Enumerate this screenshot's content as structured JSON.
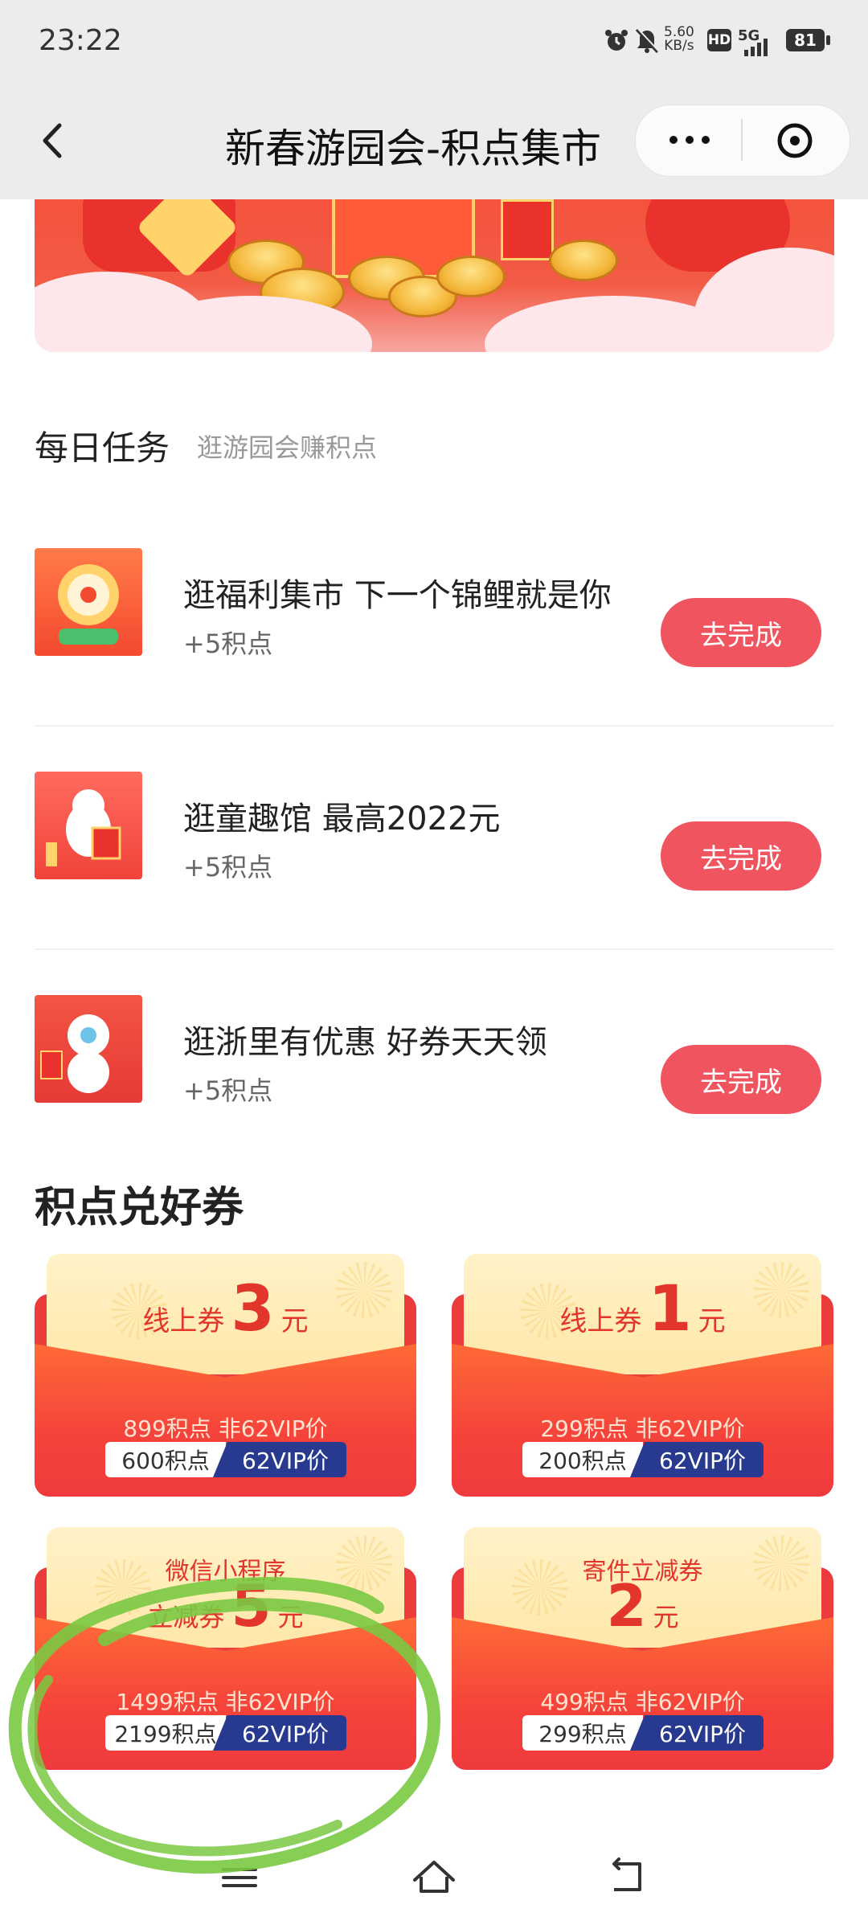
{
  "status_bar": {
    "time": "23:22",
    "net_speed_value": "5.60",
    "net_speed_unit": "KB/s",
    "hd": "HD",
    "network": "5G",
    "battery": "81"
  },
  "nav": {
    "title": "新春游园会-积点集市"
  },
  "daily": {
    "title": "每日任务",
    "subtitle": "逛游园会赚积点",
    "tasks": [
      {
        "title": "逛福利集市 下一个锦鲤就是你",
        "points": "+5积点",
        "button": "去完成"
      },
      {
        "title": "逛童趣馆 最高2022元",
        "points": "+5积点",
        "button": "去完成"
      },
      {
        "title": "逛浙里有优惠 好券天天领",
        "points": "+5积点",
        "button": "去完成"
      }
    ]
  },
  "coupons": {
    "title": "积点兑好券",
    "items": [
      {
        "prefix": "线上券",
        "amount": "3",
        "unit": "元",
        "orig": "899积点  非62VIP价",
        "pts": "600积点",
        "vip": "62VIP价"
      },
      {
        "prefix": "线上券",
        "amount": "1",
        "unit": "元",
        "orig": "299积点  非62VIP价",
        "pts": "200积点",
        "vip": "62VIP价"
      },
      {
        "line1": "微信小程序",
        "line2_prefix": "立减券",
        "amount": "5",
        "unit": "元",
        "orig": "1499积点  非62VIP价",
        "pts": "2199积点",
        "vip": "62VIP价"
      },
      {
        "line1": "寄件立减券",
        "amount": "2",
        "unit": "元",
        "orig": "499积点  非62VIP价",
        "pts": "299积点",
        "vip": "62VIP价"
      }
    ]
  },
  "colors": {
    "accent": "#f0555f",
    "coupon_red": "#f1453c",
    "vip_blue": "#283a8f",
    "annotation_green": "#7ac943"
  },
  "icons": [
    "alarm-icon",
    "mute-icon",
    "back-icon",
    "more-icon",
    "close-icon",
    "menu-icon",
    "home-icon",
    "return-icon"
  ]
}
